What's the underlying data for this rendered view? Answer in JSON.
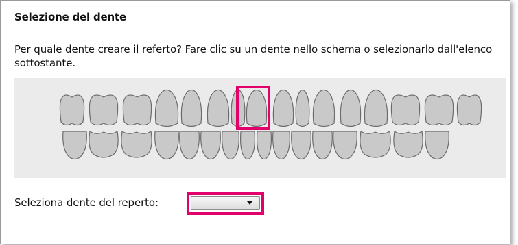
{
  "dialog": {
    "title": "Selezione del dente",
    "instruction": "Per quale dente creare il referto? Fare clic su un dente nello schema o selezionarlo dall'elenco sottostante.",
    "select_label": "Seleziona dente del reperto:",
    "select_value": "",
    "highlight_color": "#e2006b"
  },
  "scheme": {
    "upper_teeth_count": 14,
    "lower_teeth_count": 16,
    "highlighted_tooth": "upper central incisor"
  }
}
